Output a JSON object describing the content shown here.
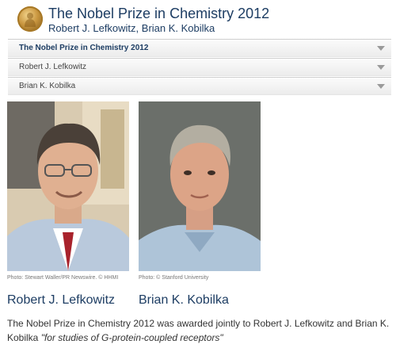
{
  "header": {
    "title": "The Nobel Prize in Chemistry 2012",
    "subtitle": "Robert J. Lefkowitz, Brian K. Kobilka",
    "logo_icon": "nobel-medal-icon"
  },
  "menu": {
    "items": [
      {
        "label": "The Nobel Prize in Chemistry 2012",
        "active": true
      },
      {
        "label": "Robert J. Lefkowitz",
        "active": false
      },
      {
        "label": "Brian K. Kobilka",
        "active": false
      }
    ],
    "arrow_icon": "chevron-down-icon"
  },
  "laureates": [
    {
      "name": "Robert J. Lefkowitz",
      "photo_credit": "Photo: Stewart Waller/PR Newswire. © HHMI"
    },
    {
      "name": "Brian K. Kobilka",
      "photo_credit": "Photo: © Stanford University"
    }
  ],
  "summary": {
    "text": "The Nobel Prize in Chemistry 2012 was awarded jointly to Robert J. Lefkowitz and Brian K. Kobilka ",
    "motivation": "\"for studies of G-protein-coupled receptors\""
  },
  "colors": {
    "title": "#1d3d63",
    "menu_bg": "#ececec",
    "gold": "#c9963f"
  }
}
